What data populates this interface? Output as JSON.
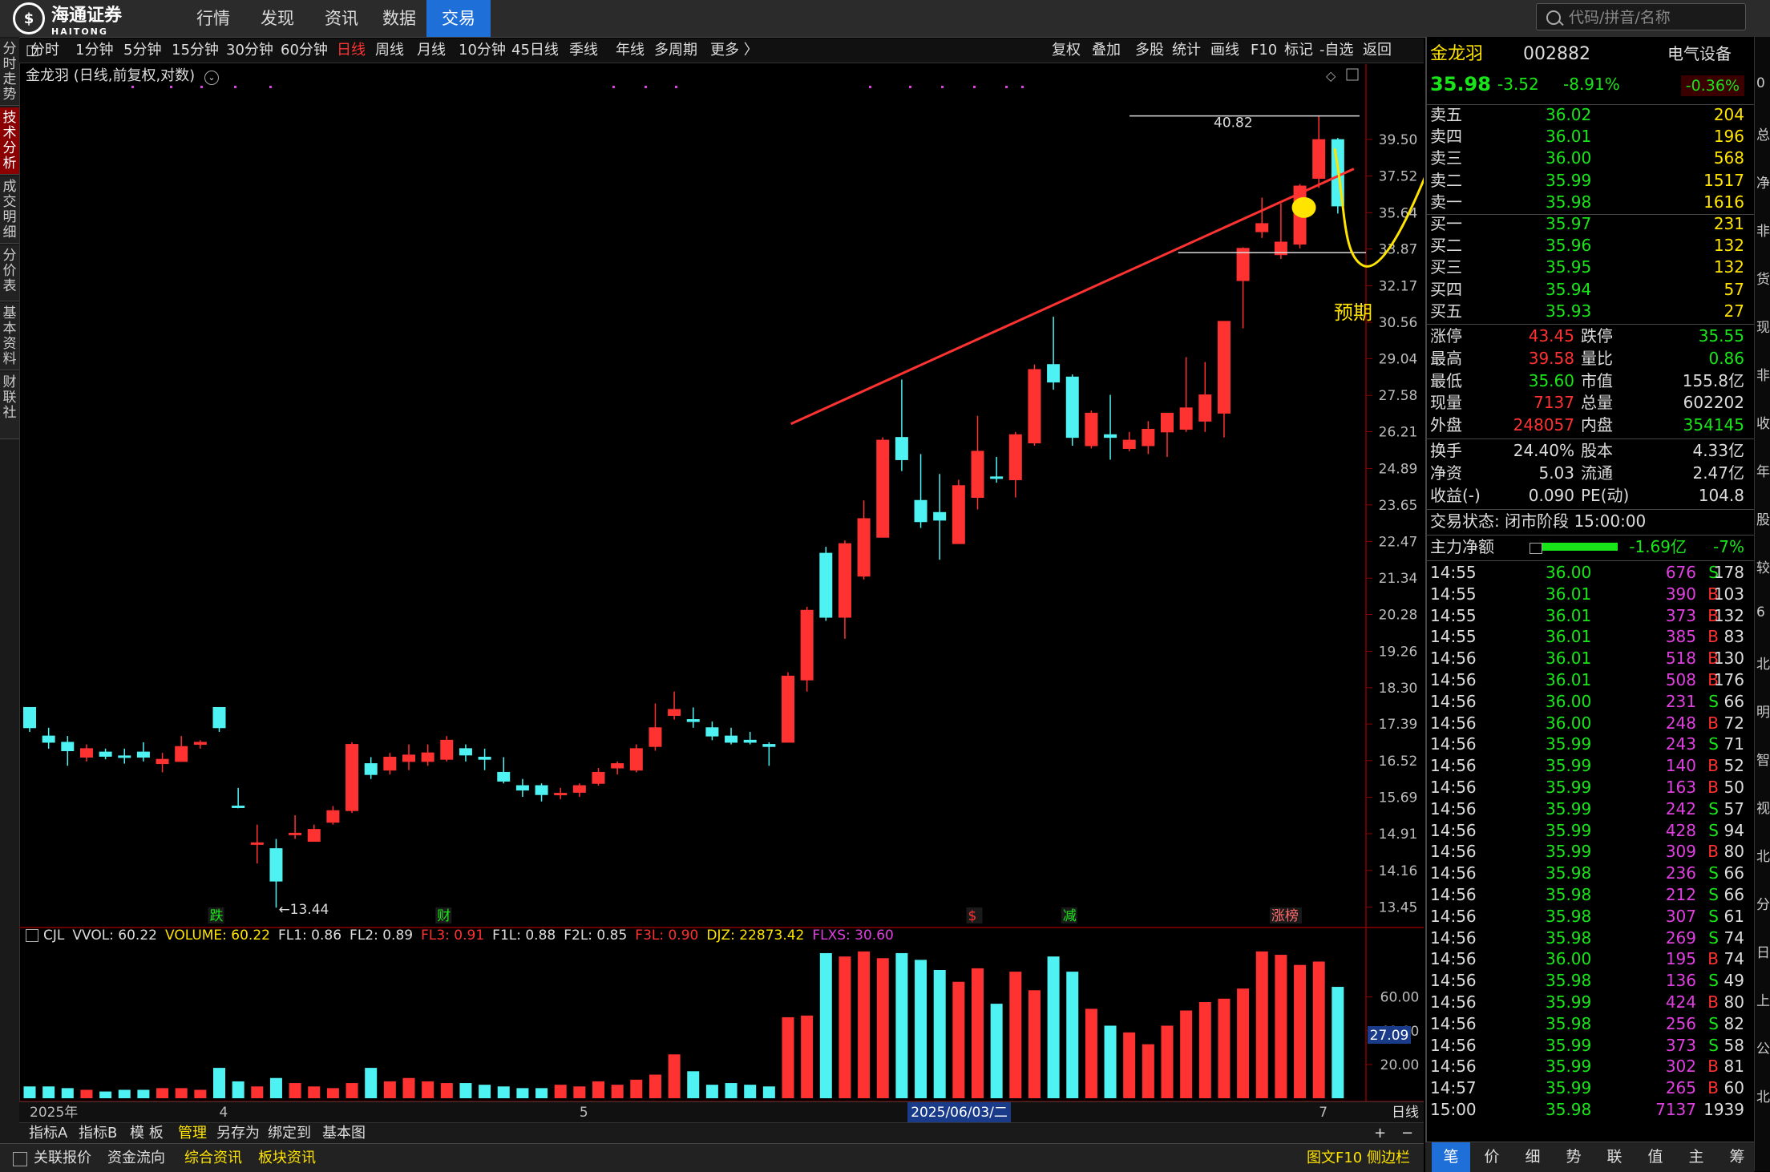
{
  "app": {
    "logo_text": "海通证券",
    "logo_sub": "HAITONG",
    "logo_char": "$"
  },
  "topnav": [
    "行情",
    "发现",
    "资讯",
    "数据",
    "交易"
  ],
  "search_placeholder": "代码/拼音/名称",
  "left_tabs": [
    "分时走势",
    "技术分析",
    "成交明细",
    "分价表",
    "基本资料",
    "财联社"
  ],
  "toolbar_left": [
    "分时",
    "1分钟",
    "5分钟",
    "15分钟",
    "30分钟",
    "60分钟",
    "日线",
    "周线",
    "月线",
    "10分钟",
    "45日线",
    "季线",
    "年线",
    "多周期",
    "更多 〉"
  ],
  "toolbar_right": [
    "复权",
    "叠加",
    "多股",
    "统计",
    "画线",
    "F10",
    "标记",
    "-自选",
    "返回"
  ],
  "chart_title": "金龙羽 (日线,前复权,对数)",
  "chart_data": {
    "type": "candlestick",
    "title": "金龙羽 (日线,前复权,对数)",
    "y_ticks": [
      39.5,
      37.52,
      35.64,
      33.87,
      32.17,
      30.56,
      29.04,
      27.58,
      26.21,
      24.89,
      23.65,
      22.47,
      21.34,
      20.28,
      19.26,
      18.3,
      17.39,
      16.52,
      15.69,
      14.91,
      14.16,
      13.45
    ],
    "ylim": [
      13.1,
      41.5
    ],
    "candles": [
      {
        "o": 17.8,
        "c": 17.3,
        "h": 17.8,
        "l": 17.2
      },
      {
        "o": 17.1,
        "c": 16.95,
        "h": 17.3,
        "l": 16.8
      },
      {
        "o": 16.95,
        "c": 16.75,
        "h": 17.1,
        "l": 16.4
      },
      {
        "o": 16.6,
        "c": 16.8,
        "h": 16.9,
        "l": 16.5
      },
      {
        "o": 16.72,
        "c": 16.62,
        "h": 16.8,
        "l": 16.55
      },
      {
        "o": 16.63,
        "c": 16.6,
        "h": 16.8,
        "l": 16.45
      },
      {
        "o": 16.72,
        "c": 16.6,
        "h": 16.95,
        "l": 16.5
      },
      {
        "o": 16.45,
        "c": 16.55,
        "h": 16.7,
        "l": 16.25
      },
      {
        "o": 16.5,
        "c": 16.85,
        "h": 17.1,
        "l": 16.5
      },
      {
        "o": 16.9,
        "c": 16.95,
        "h": 17.0,
        "l": 16.8
      },
      {
        "o": 17.8,
        "c": 17.3,
        "h": 17.8,
        "l": 17.2
      },
      {
        "o": 15.5,
        "c": 15.48,
        "h": 15.9,
        "l": 15.45
      },
      {
        "o": 14.7,
        "c": 14.72,
        "h": 15.1,
        "l": 14.3
      },
      {
        "o": 14.6,
        "c": 13.95,
        "h": 14.8,
        "l": 13.44
      },
      {
        "o": 14.9,
        "c": 14.92,
        "h": 15.3,
        "l": 14.8
      },
      {
        "o": 14.75,
        "c": 15.0,
        "h": 15.1,
        "l": 14.75
      },
      {
        "o": 15.15,
        "c": 15.4,
        "h": 15.5,
        "l": 15.1
      },
      {
        "o": 15.4,
        "c": 16.9,
        "h": 16.95,
        "l": 15.35
      },
      {
        "o": 16.45,
        "c": 16.2,
        "h": 16.6,
        "l": 16.1
      },
      {
        "o": 16.3,
        "c": 16.6,
        "h": 16.7,
        "l": 16.2
      },
      {
        "o": 16.5,
        "c": 16.65,
        "h": 16.9,
        "l": 16.3
      },
      {
        "o": 16.5,
        "c": 16.7,
        "h": 16.9,
        "l": 16.4
      },
      {
        "o": 16.55,
        "c": 17.0,
        "h": 17.1,
        "l": 16.5
      },
      {
        "o": 16.8,
        "c": 16.65,
        "h": 16.9,
        "l": 16.5
      },
      {
        "o": 16.6,
        "c": 16.55,
        "h": 16.8,
        "l": 16.3
      },
      {
        "o": 16.25,
        "c": 16.05,
        "h": 16.6,
        "l": 16.0
      },
      {
        "o": 15.95,
        "c": 15.85,
        "h": 16.1,
        "l": 15.7
      },
      {
        "o": 15.95,
        "c": 15.75,
        "h": 16.0,
        "l": 15.6
      },
      {
        "o": 15.75,
        "c": 15.78,
        "h": 15.9,
        "l": 15.65
      },
      {
        "o": 15.8,
        "c": 15.95,
        "h": 16.0,
        "l": 15.7
      },
      {
        "o": 16.0,
        "c": 16.25,
        "h": 16.35,
        "l": 15.95
      },
      {
        "o": 16.35,
        "c": 16.45,
        "h": 16.5,
        "l": 16.2
      },
      {
        "o": 16.3,
        "c": 16.8,
        "h": 16.9,
        "l": 16.25
      },
      {
        "o": 16.85,
        "c": 17.3,
        "h": 17.9,
        "l": 16.75
      },
      {
        "o": 17.6,
        "c": 17.75,
        "h": 18.2,
        "l": 17.5
      },
      {
        "o": 17.5,
        "c": 17.45,
        "h": 17.8,
        "l": 17.3
      },
      {
        "o": 17.3,
        "c": 17.1,
        "h": 17.45,
        "l": 17.0
      },
      {
        "o": 17.1,
        "c": 16.95,
        "h": 17.3,
        "l": 16.9
      },
      {
        "o": 17.0,
        "c": 16.95,
        "h": 17.2,
        "l": 16.9
      },
      {
        "o": 16.9,
        "c": 16.85,
        "h": 16.95,
        "l": 16.4
      },
      {
        "o": 16.95,
        "c": 18.6,
        "h": 18.7,
        "l": 16.95
      },
      {
        "o": 18.5,
        "c": 20.4,
        "h": 20.5,
        "l": 18.2
      },
      {
        "o": 22.1,
        "c": 20.2,
        "h": 22.3,
        "l": 20.1
      },
      {
        "o": 20.2,
        "c": 22.4,
        "h": 22.5,
        "l": 19.6
      },
      {
        "o": 21.4,
        "c": 23.2,
        "h": 23.8,
        "l": 21.3
      },
      {
        "o": 22.6,
        "c": 25.9,
        "h": 26.0,
        "l": 22.6
      },
      {
        "o": 26.0,
        "c": 25.2,
        "h": 28.2,
        "l": 24.8
      },
      {
        "o": 23.8,
        "c": 23.1,
        "h": 25.4,
        "l": 22.9
      },
      {
        "o": 23.4,
        "c": 23.15,
        "h": 24.7,
        "l": 21.9
      },
      {
        "o": 22.4,
        "c": 24.3,
        "h": 24.5,
        "l": 22.4
      },
      {
        "o": 23.9,
        "c": 25.5,
        "h": 26.8,
        "l": 23.5
      },
      {
        "o": 24.6,
        "c": 24.55,
        "h": 25.3,
        "l": 24.4
      },
      {
        "o": 24.5,
        "c": 26.1,
        "h": 26.2,
        "l": 23.9
      },
      {
        "o": 25.8,
        "c": 28.6,
        "h": 28.8,
        "l": 25.7
      },
      {
        "o": 28.8,
        "c": 28.1,
        "h": 30.8,
        "l": 27.8
      },
      {
        "o": 28.3,
        "c": 26.0,
        "h": 28.4,
        "l": 25.7
      },
      {
        "o": 25.7,
        "c": 26.9,
        "h": 27.0,
        "l": 25.6
      },
      {
        "o": 26.1,
        "c": 26.0,
        "h": 27.6,
        "l": 25.2
      },
      {
        "o": 25.6,
        "c": 25.9,
        "h": 26.2,
        "l": 25.5
      },
      {
        "o": 25.7,
        "c": 26.3,
        "h": 26.6,
        "l": 25.4
      },
      {
        "o": 26.2,
        "c": 26.9,
        "h": 26.9,
        "l": 25.3
      },
      {
        "o": 26.3,
        "c": 27.1,
        "h": 29.1,
        "l": 26.2
      },
      {
        "o": 26.6,
        "c": 27.6,
        "h": 28.9,
        "l": 26.2
      },
      {
        "o": 26.9,
        "c": 30.6,
        "h": 30.6,
        "l": 26.0
      },
      {
        "o": 32.4,
        "c": 33.9,
        "h": 33.95,
        "l": 30.3
      },
      {
        "o": 34.7,
        "c": 35.1,
        "h": 36.4,
        "l": 34.4
      },
      {
        "o": 33.6,
        "c": 34.2,
        "h": 36.1,
        "l": 33.4
      },
      {
        "o": 34.1,
        "c": 37.0,
        "h": 37.1,
        "l": 33.9
      },
      {
        "o": 37.4,
        "c": 39.49,
        "h": 40.82,
        "l": 36.9
      },
      {
        "o": 39.49,
        "c": 35.98,
        "h": 39.58,
        "l": 35.6
      }
    ],
    "annotations": {
      "high_label": "40.82",
      "low_label": "←13.44",
      "prediction_text": "预期"
    },
    "event_markers": [
      {
        "idx": 10,
        "text": "跌"
      },
      {
        "idx": 22,
        "text": "财"
      },
      {
        "idx": 50,
        "text": "$"
      },
      {
        "idx": 55,
        "text": "减"
      },
      {
        "idx": 66,
        "text": "涨榜"
      }
    ],
    "volume": {
      "values": [
        7,
        7,
        6,
        5,
        4,
        5,
        5,
        6,
        6,
        5,
        18,
        10,
        7,
        12,
        9,
        7,
        6,
        9,
        18,
        10,
        12,
        10,
        9,
        9,
        8,
        7,
        6,
        6,
        8,
        7,
        10,
        8,
        11,
        14,
        26,
        16,
        8,
        9,
        8,
        7,
        48,
        49,
        86,
        84,
        87,
        83,
        86,
        82,
        76,
        69,
        77,
        56,
        75,
        64,
        84,
        75,
        53,
        43,
        39,
        32,
        43,
        52,
        57,
        59,
        65,
        87,
        85,
        79,
        81,
        66
      ],
      "y_ticks": [
        60.0,
        40.0,
        20.0
      ],
      "current_label": "27.09",
      "ylim": [
        0,
        95
      ]
    },
    "xlabels": [
      {
        "idx": 0,
        "text": "2025年"
      },
      {
        "idx": 10,
        "text": "4"
      },
      {
        "idx": 29,
        "text": "5"
      },
      {
        "idx": 48,
        "text": "2025/06/03/二"
      },
      {
        "idx": 68,
        "text": "7"
      }
    ]
  },
  "volume_header": [
    {
      "t": "CJL",
      "c": "#ddd"
    },
    {
      "t": "VVOL: 60.22",
      "c": "#ddd"
    },
    {
      "t": "VOLUME: 60.22",
      "c": "#ffe400"
    },
    {
      "t": "FL1: 0.86",
      "c": "#ddd"
    },
    {
      "t": "FL2: 0.89",
      "c": "#ddd"
    },
    {
      "t": "FL3: 0.91",
      "c": "#ff3232"
    },
    {
      "t": "F1L: 0.88",
      "c": "#ddd"
    },
    {
      "t": "F2L: 0.85",
      "c": "#ddd"
    },
    {
      "t": "F3L: 0.90",
      "c": "#ff3232"
    },
    {
      "t": "DJZ: 22873.42",
      "c": "#ffe400"
    },
    {
      "t": "FLXS: 30.60",
      "c": "#e040e0"
    }
  ],
  "period_label": "日线",
  "bottom_tabs1": [
    "指标A",
    "指标B",
    "模 板",
    "管理",
    "另存为",
    "绑定到",
    "基本图"
  ],
  "bottom_tabs2": [
    "关联报价",
    "资金流向",
    "综合资讯",
    "板块资讯"
  ],
  "bottom_right": "图文F10 侧边栏",
  "quote": {
    "name": "金龙羽",
    "code": "002882",
    "sector": "电气设备",
    "sector_pct": "-0.36%",
    "price": "35.98",
    "change": "-3.52",
    "pct": "-8.91%",
    "asks": [
      [
        "卖五",
        "36.02",
        "204"
      ],
      [
        "卖四",
        "36.01",
        "196"
      ],
      [
        "卖三",
        "36.00",
        "568"
      ],
      [
        "卖二",
        "35.99",
        "1517"
      ],
      [
        "卖一",
        "35.98",
        "1616"
      ]
    ],
    "bids": [
      [
        "买一",
        "35.97",
        "231"
      ],
      [
        "买二",
        "35.96",
        "132"
      ],
      [
        "买三",
        "35.95",
        "132"
      ],
      [
        "买四",
        "35.94",
        "57"
      ],
      [
        "买五",
        "35.93",
        "27"
      ]
    ],
    "stats": [
      [
        "涨停",
        "43.45",
        "跌停",
        "35.55"
      ],
      [
        "最高",
        "39.58",
        "量比",
        "0.86"
      ],
      [
        "最低",
        "35.60",
        "市值",
        "155.8亿"
      ],
      [
        "现量",
        "7137",
        "总量",
        "602202"
      ],
      [
        "外盘",
        "248057",
        "内盘",
        "354145"
      ]
    ],
    "stats2": [
      [
        "换手",
        "24.40%",
        "股本",
        "4.33亿"
      ],
      [
        "净资",
        "5.03",
        "流通",
        "2.47亿"
      ],
      [
        "收益(-)",
        "0.090",
        "PE(动)",
        "104.8"
      ]
    ],
    "status": "交易状态: 闭市阶段 15:00:00",
    "main_flow_label": "主力净额",
    "main_flow_value": "-1.69亿",
    "main_flow_pct": "-7%",
    "ticks": [
      [
        "14:55",
        "36.00",
        "676",
        "S",
        "178"
      ],
      [
        "14:55",
        "36.01",
        "390",
        "B",
        "103"
      ],
      [
        "14:55",
        "36.01",
        "373",
        "B",
        "132"
      ],
      [
        "14:55",
        "36.01",
        "385",
        "B",
        "83"
      ],
      [
        "14:56",
        "36.01",
        "518",
        "B",
        "130"
      ],
      [
        "14:56",
        "36.01",
        "508",
        "B",
        "176"
      ],
      [
        "14:56",
        "36.00",
        "231",
        "S",
        "66"
      ],
      [
        "14:56",
        "36.00",
        "248",
        "B",
        "72"
      ],
      [
        "14:56",
        "35.99",
        "243",
        "S",
        "71"
      ],
      [
        "14:56",
        "35.99",
        "140",
        "B",
        "52"
      ],
      [
        "14:56",
        "35.99",
        "163",
        "B",
        "50"
      ],
      [
        "14:56",
        "35.99",
        "242",
        "S",
        "57"
      ],
      [
        "14:56",
        "35.99",
        "428",
        "S",
        "94"
      ],
      [
        "14:56",
        "35.99",
        "309",
        "B",
        "80"
      ],
      [
        "14:56",
        "35.98",
        "236",
        "S",
        "66"
      ],
      [
        "14:56",
        "35.98",
        "212",
        "S",
        "66"
      ],
      [
        "14:56",
        "35.98",
        "307",
        "S",
        "61"
      ],
      [
        "14:56",
        "35.98",
        "269",
        "S",
        "74"
      ],
      [
        "14:56",
        "36.00",
        "195",
        "B",
        "74"
      ],
      [
        "14:56",
        "35.98",
        "136",
        "S",
        "49"
      ],
      [
        "14:56",
        "35.99",
        "424",
        "B",
        "80"
      ],
      [
        "14:56",
        "35.98",
        "256",
        "S",
        "82"
      ],
      [
        "14:56",
        "35.99",
        "373",
        "S",
        "58"
      ],
      [
        "14:56",
        "35.99",
        "302",
        "B",
        "81"
      ],
      [
        "14:57",
        "35.99",
        "265",
        "B",
        "60"
      ],
      [
        "15:00",
        "35.98",
        "7137",
        "",
        "1939"
      ]
    ]
  },
  "right_bottom_tabs": [
    "笔",
    "价",
    "细",
    "势",
    "联",
    "值",
    "主",
    "筹"
  ],
  "right_strip": [
    "0",
    "总",
    "净",
    "非",
    "货",
    "现",
    "非",
    "收",
    "年",
    "股",
    "较",
    "6",
    "北",
    "明",
    "智",
    "视",
    "北",
    "分",
    "日",
    "上",
    "公",
    "北"
  ]
}
